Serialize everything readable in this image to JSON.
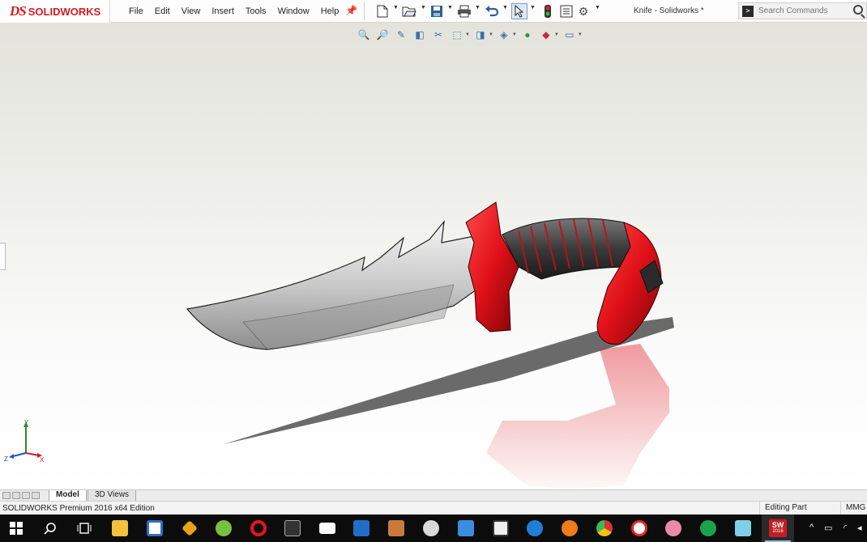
{
  "app": {
    "logo_mark": "DS",
    "logo_text": "SOLIDWORKS",
    "menu": [
      "File",
      "Edit",
      "View",
      "Insert",
      "Tools",
      "Window",
      "Help"
    ],
    "document_title": "Knife - Solidworks *",
    "search_placeholder": "Search Commands"
  },
  "toolbar": {
    "icons": [
      "new-document-icon",
      "open-icon",
      "save-icon",
      "print-icon",
      "undo-icon",
      "select-icon",
      "traffic-light-icon",
      "file-properties-icon",
      "options-gear-icon"
    ]
  },
  "heads_up_toolbar": {
    "icons": [
      "zoom-to-fit-icon",
      "zoom-to-area-icon",
      "previous-view-icon",
      "section-view-icon",
      "dynamic-annotation-icon",
      "view-orientation-icon",
      "display-style-icon",
      "hide-show-items-icon",
      "edit-appearance-icon",
      "apply-scene-icon",
      "view-settings-icon"
    ]
  },
  "triad": {
    "x": "X",
    "y": "Y",
    "z": "Z"
  },
  "tabs": {
    "model": "Model",
    "views_3d": "3D Views"
  },
  "status": {
    "edition": "SOLIDWORKS Premium 2016 x64 Edition",
    "mode": "Editing Part",
    "units": "MMG"
  },
  "taskbar": {
    "apps": [
      "windows-start-icon",
      "search-icon",
      "task-view-icon",
      "file-explorer-icon",
      "store-icon",
      "sketch-app-icon",
      "utorrent-icon",
      "opera-icon",
      "calculator-icon",
      "mail-icon",
      "outlook-icon",
      "photo-app-icon",
      "paint-icon",
      "remote-desktop-icon",
      "video-editor-icon",
      "edge-icon",
      "firefox-icon",
      "chrome-icon",
      "yandex-icon",
      "paint-3d-icon",
      "media-player-icon",
      "cube-app-icon",
      "solidworks-2016-icon"
    ],
    "solidworks_label": "SW",
    "solidworks_sub": "2016"
  },
  "colors": {
    "brand_red": "#d71920",
    "handle_red": "#e01018",
    "taskbar": "#0c0c0c"
  }
}
